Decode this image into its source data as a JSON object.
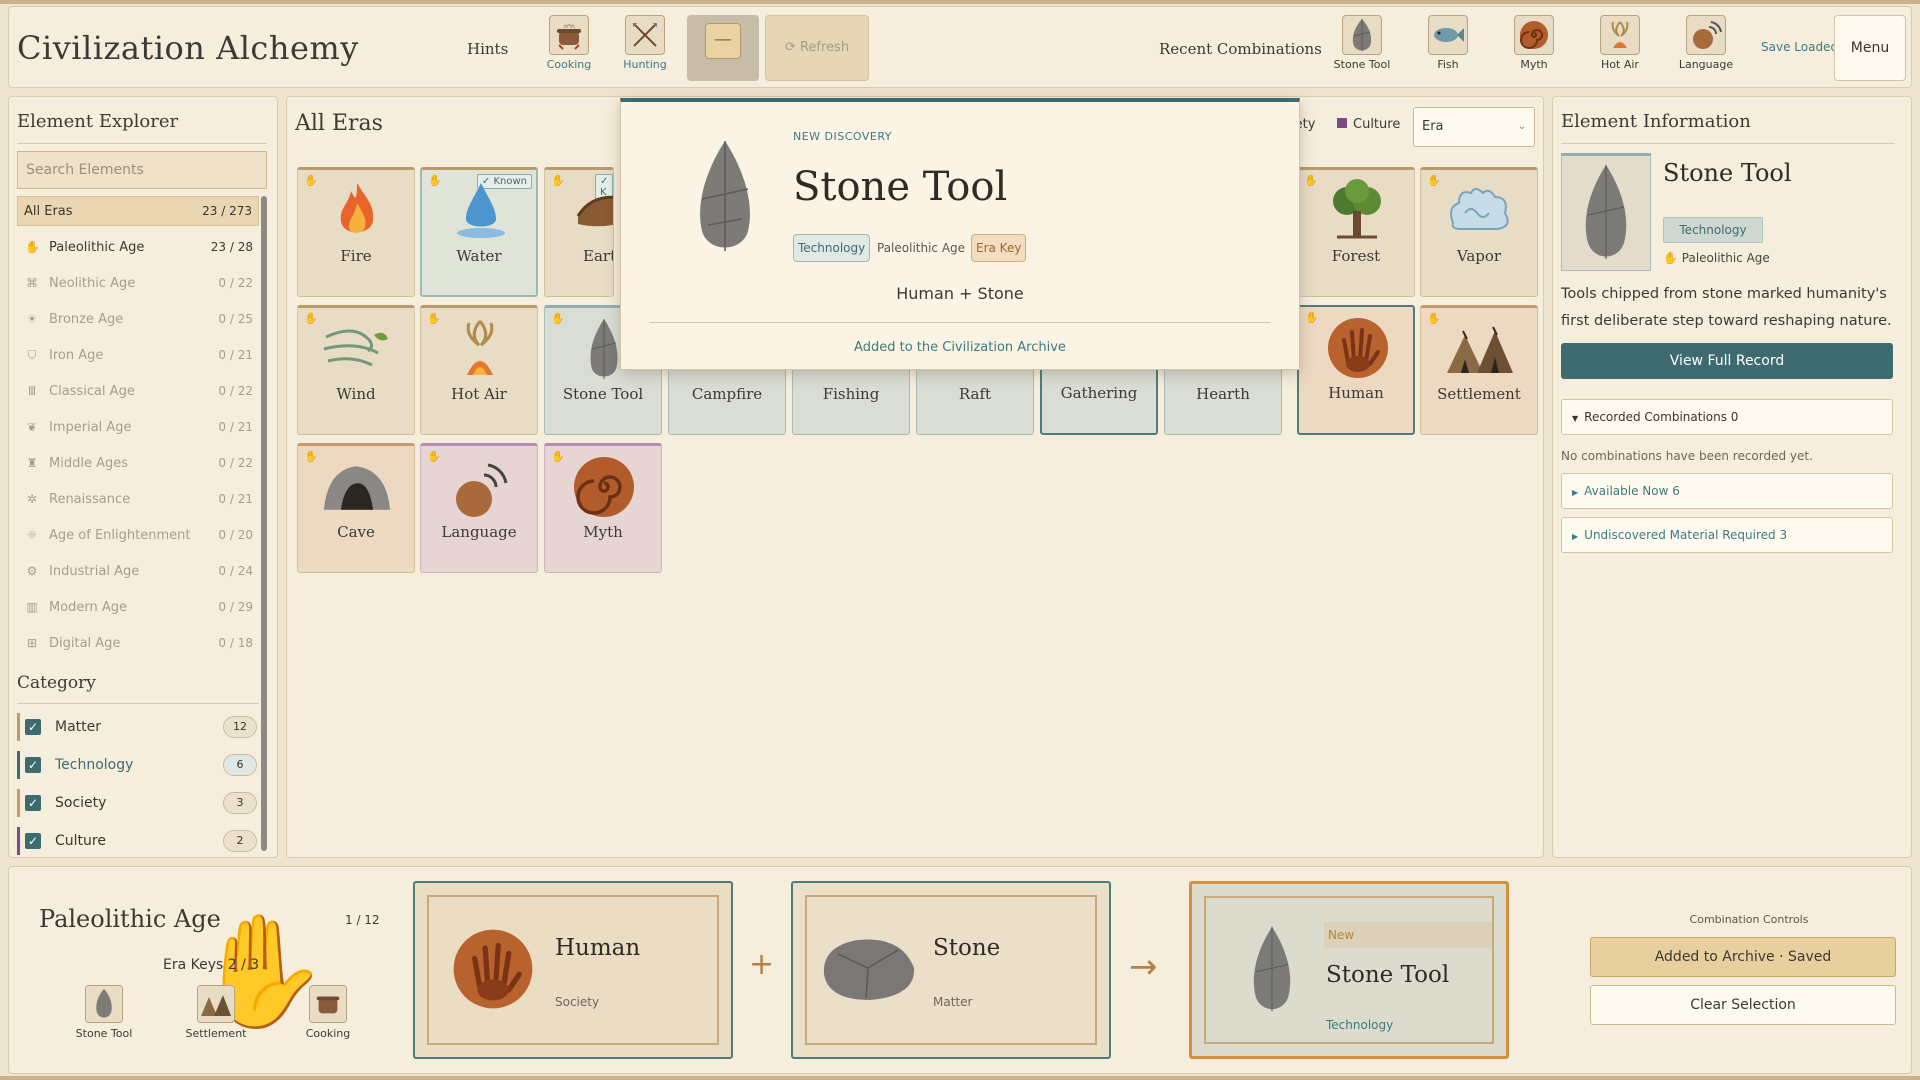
{
  "app": {
    "title": "Civilization Alchemy"
  },
  "header": {
    "hints_label": "Hints",
    "hints": [
      {
        "label": "Cooking",
        "icon": "cooking-pot-icon"
      },
      {
        "label": "Hunting",
        "icon": "crossed-spears-icon"
      }
    ],
    "placeholder_button_glyph": "—",
    "refresh_label": "⟳ Refresh",
    "recent_label": "Recent Combinations",
    "recent": [
      {
        "label": "Stone Tool",
        "icon": "stone-tool-icon"
      },
      {
        "label": "Fish",
        "icon": "fish-icon"
      },
      {
        "label": "Myth",
        "icon": "myth-spiral-icon"
      },
      {
        "label": "Hot Air",
        "icon": "hot-air-icon"
      },
      {
        "label": "Language",
        "icon": "language-icon"
      }
    ],
    "save_status": "Save Loaded",
    "menu_label": "Menu"
  },
  "explorer": {
    "title": "Element Explorer",
    "search_placeholder": "Search Elements",
    "all_eras": {
      "label": "All Eras",
      "count": "23 / 273"
    },
    "eras": [
      {
        "label": "Paleolithic Age",
        "count": "23 / 28",
        "icon": "hand-icon",
        "active": true
      },
      {
        "label": "Neolithic Age",
        "count": "0 / 22",
        "icon": "wheat-icon"
      },
      {
        "label": "Bronze Age",
        "count": "0 / 25",
        "icon": "sun-icon"
      },
      {
        "label": "Iron Age",
        "count": "0 / 21",
        "icon": "shield-icon"
      },
      {
        "label": "Classical Age",
        "count": "0 / 22",
        "icon": "column-icon"
      },
      {
        "label": "Imperial Age",
        "count": "0 / 21",
        "icon": "laurel-icon"
      },
      {
        "label": "Middle Ages",
        "count": "0 / 22",
        "icon": "castle-icon"
      },
      {
        "label": "Renaissance",
        "count": "0 / 21",
        "icon": "compass-icon"
      },
      {
        "label": "Age of Enlightenment",
        "count": "0 / 20",
        "icon": "lamp-icon"
      },
      {
        "label": "Industrial Age",
        "count": "0 / 24",
        "icon": "factory-icon"
      },
      {
        "label": "Modern Age",
        "count": "0 / 29",
        "icon": "city-icon"
      },
      {
        "label": "Digital Age",
        "count": "0 / 18",
        "icon": "chip-icon"
      }
    ],
    "category_title": "Category",
    "categories": [
      {
        "label": "Matter",
        "count": "12",
        "color": "#b89a6b",
        "text_color": "#3b3a33"
      },
      {
        "label": "Technology",
        "count": "6",
        "color": "#3d6b6f",
        "text_color": "#3d6b6f"
      },
      {
        "label": "Society",
        "count": "3",
        "color": "#c69a6c",
        "text_color": "#3b3a33"
      },
      {
        "label": "Culture",
        "count": "2",
        "color": "#7c4a86",
        "text_color": "#3b3a33"
      }
    ]
  },
  "grid": {
    "title": "All Eras",
    "legend_society": "iety",
    "legend_culture": "Culture",
    "era_filter": "Era",
    "known_badge": "✓ Known",
    "known_badge_short": "✓ K",
    "cards": [
      {
        "name": "Fire",
        "category": "matter",
        "icon": "fire-icon"
      },
      {
        "name": "Water",
        "category": "matter",
        "icon": "water-drop-icon",
        "known": true
      },
      {
        "name": "Earth",
        "category": "matter",
        "icon": "earth-icon",
        "known": true
      },
      {
        "name": "Forest",
        "category": "matter",
        "icon": "tree-icon"
      },
      {
        "name": "Vapor",
        "category": "matter",
        "icon": "vapor-icon"
      },
      {
        "name": "Wind",
        "category": "matter",
        "icon": "wind-icon"
      },
      {
        "name": "Hot Air",
        "category": "matter",
        "icon": "hot-air-icon"
      },
      {
        "name": "Stone Tool",
        "category": "technology",
        "icon": "stone-tool-icon"
      },
      {
        "name": "Campfire",
        "category": "technology",
        "icon": "campfire-icon"
      },
      {
        "name": "Fishing",
        "category": "technology",
        "icon": "fishing-icon"
      },
      {
        "name": "Raft",
        "category": "technology",
        "icon": "raft-icon"
      },
      {
        "name": "Gathering",
        "category": "technology",
        "icon": "gathering-icon"
      },
      {
        "name": "Hearth",
        "category": "technology",
        "icon": "hearth-icon"
      },
      {
        "name": "Human",
        "category": "society",
        "icon": "hand-print-icon"
      },
      {
        "name": "Settlement",
        "category": "society",
        "icon": "tents-icon"
      },
      {
        "name": "Cave",
        "category": "matter",
        "icon": "cave-icon"
      },
      {
        "name": "Language",
        "category": "culture",
        "icon": "language-icon"
      },
      {
        "name": "Myth",
        "category": "culture",
        "icon": "myth-spiral-icon"
      }
    ]
  },
  "discovery": {
    "kicker": "NEW DISCOVERY",
    "title": "Stone Tool",
    "tag_category": "Technology",
    "tag_era": "Paleolithic Age",
    "tag_key": "Era Key",
    "recipe": "Human + Stone",
    "footer": "Added to the Civilization Archive"
  },
  "info": {
    "title": "Element Information",
    "name": "Stone Tool",
    "category": "Technology",
    "era": "Paleolithic Age",
    "description": "Tools chipped from stone marked humanity's first deliberate step toward reshaping nature.",
    "full_record_label": "View Full Record",
    "recorded_label": "Recorded Combinations  0",
    "recorded_empty": "No combinations have been recorded yet.",
    "available_label": "Available Now  6",
    "undiscovered_label": "Undiscovered Material Required  3"
  },
  "combine": {
    "era_title": "Paleolithic Age",
    "progress": "1 / 12",
    "era_keys": "Era Keys  2 / 3",
    "keys": [
      {
        "label": "Stone Tool",
        "icon": "stone-tool-icon",
        "done": true
      },
      {
        "label": "Settlement",
        "icon": "tents-icon",
        "done": true
      },
      {
        "label": "Cooking",
        "icon": "cooking-pot-icon",
        "done": false
      }
    ],
    "slot1": {
      "name": "Human",
      "category": "Society"
    },
    "slot2": {
      "name": "Stone",
      "category": "Matter"
    },
    "plus": "+",
    "arrow": "→",
    "result": {
      "badge": "New",
      "name": "Stone Tool",
      "category": "Technology"
    },
    "controls_title": "Combination Controls",
    "archive_label": "Added to Archive · Saved",
    "clear_label": "Clear Selection"
  }
}
